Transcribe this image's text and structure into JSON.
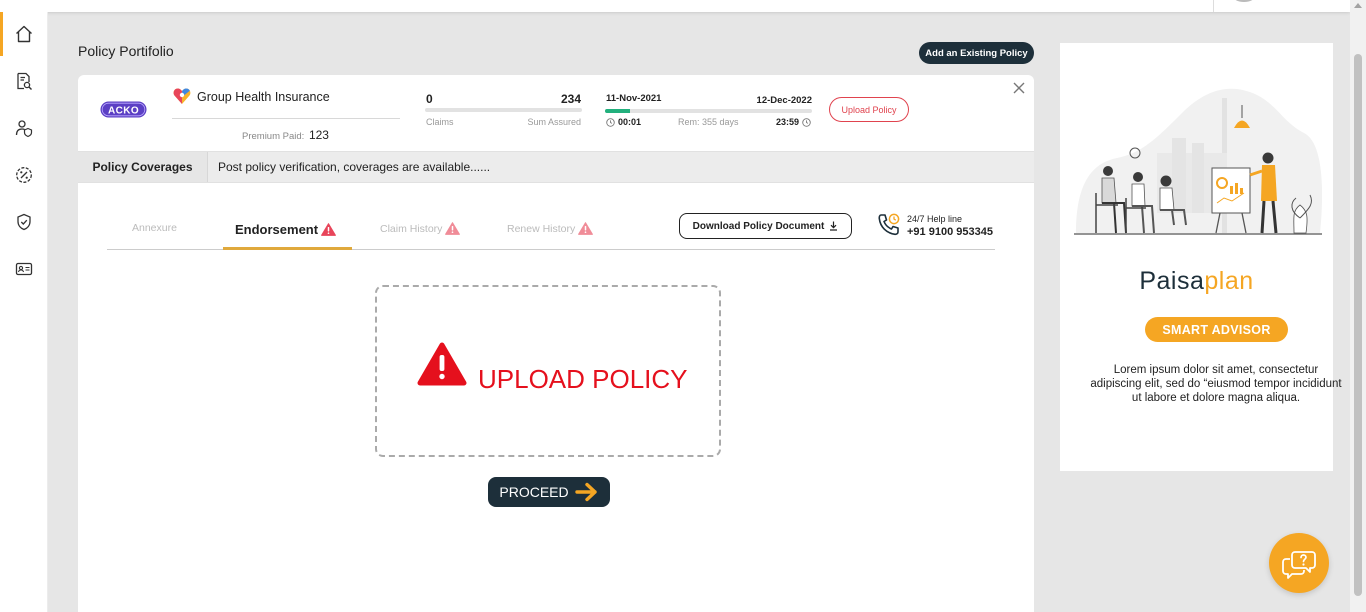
{
  "page": {
    "title": "Policy Portifolio",
    "add_policy_label": "Add an Existing Policy"
  },
  "sidebar": {
    "items": [
      {
        "icon": "home-icon",
        "active": true
      },
      {
        "icon": "document-search-icon",
        "active": false
      },
      {
        "icon": "user-shield-icon",
        "active": false
      },
      {
        "icon": "percent-badge-icon",
        "active": false
      },
      {
        "icon": "shield-check-icon",
        "active": false
      },
      {
        "icon": "id-card-icon",
        "active": false
      }
    ]
  },
  "policy": {
    "insurer_logo_text": "ACKO",
    "product_name": "Group Health Insurance",
    "premium_label": "Premium Paid:",
    "premium_value": "123",
    "claims_count": "0",
    "claims_label": "Claims",
    "sum_assured": "234",
    "sum_assured_label": "Sum Assured",
    "start_date": "11-Nov-2021",
    "end_date": "12-Dec-2022",
    "start_time": "00:01",
    "end_time": "23:59",
    "remaining": "Rem: 355 days",
    "tenure_progress": 0.12,
    "upload_label": "Upload Policy"
  },
  "coverage": {
    "label": "Policy Coverages",
    "text": "Post policy verification, coverages are available......"
  },
  "tabs": [
    {
      "label": "Annexure",
      "active": false,
      "warning": false
    },
    {
      "label": "Endorsement",
      "active": true,
      "warning": true
    },
    {
      "label": "Claim History",
      "active": false,
      "warning": true
    },
    {
      "label": "Renew History",
      "active": false,
      "warning": true
    }
  ],
  "download": {
    "label": "Download Policy Document"
  },
  "helpline": {
    "label": "24/7 Help line",
    "number": "+91 9100 953345"
  },
  "upload_area": {
    "text": "UPLOAD POLICY",
    "proceed_label": "PROCEED"
  },
  "ad": {
    "brand_part1": "Paisa",
    "brand_part2": "plan",
    "button_label": "SMART ADVISOR",
    "body": "Lorem ipsum dolor sit amet, consectetur adipiscing elit, sed do “eiusmod tempor incididunt ut labore et dolore magna aliqua."
  },
  "colors": {
    "accent": "#f5a623",
    "dark": "#1d2f3a",
    "danger": "#e5101d",
    "progress": "#22b07d"
  }
}
